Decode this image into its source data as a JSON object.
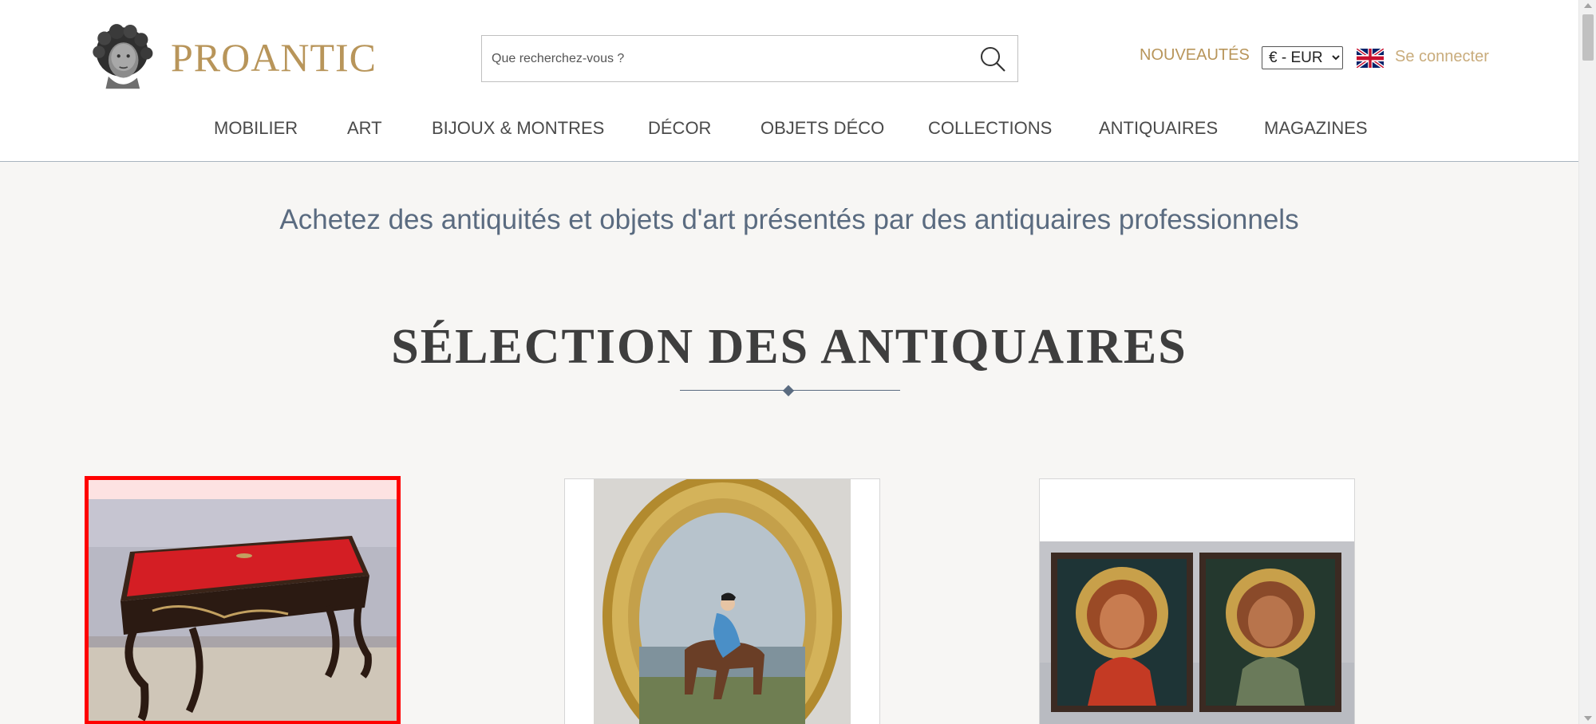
{
  "header": {
    "logo_text": "PROANTIC",
    "search_placeholder": "Que recherchez-vous ?",
    "nouveautes_label": "NOUVEAUTÉS",
    "currency_selected": "€ - EUR",
    "login_label": "Se connecter"
  },
  "nav": {
    "items": [
      "MOBILIER",
      "ART",
      "BIJOUX & MONTRES",
      "DÉCOR",
      "OBJETS DÉCO",
      "COLLECTIONS",
      "ANTIQUAIRES",
      "MAGAZINES"
    ]
  },
  "main": {
    "tagline": "Achetez des antiquités et objets d'art présentés par des antiquaires professionnels",
    "section_title": "SÉLECTION DES ANTIQUAIRES"
  },
  "colors": {
    "brand_gold": "#b8955a",
    "tagline_blue": "#5a6b80",
    "highlight_red": "#ff0000",
    "page_bg": "#f7f6f4"
  },
  "icons": [
    "bust-logo-icon",
    "search-icon",
    "uk-flag-icon"
  ]
}
